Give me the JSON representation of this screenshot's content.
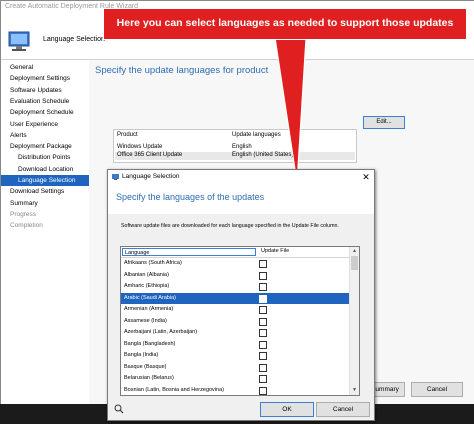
{
  "wizard": {
    "title": "Create Automatic Deployment Rule Wizard",
    "header_title": "Language Selection",
    "nav": [
      {
        "label": "General",
        "indent": 0,
        "state": "normal"
      },
      {
        "label": "Deployment Settings",
        "indent": 0,
        "state": "normal"
      },
      {
        "label": "Software Updates",
        "indent": 0,
        "state": "normal"
      },
      {
        "label": "Evaluation Schedule",
        "indent": 0,
        "state": "normal"
      },
      {
        "label": "Deployment Schedule",
        "indent": 0,
        "state": "normal"
      },
      {
        "label": "User Experience",
        "indent": 0,
        "state": "normal"
      },
      {
        "label": "Alerts",
        "indent": 0,
        "state": "normal"
      },
      {
        "label": "Deployment Package",
        "indent": 0,
        "state": "normal"
      },
      {
        "label": "Distribution Points",
        "indent": 1,
        "state": "normal"
      },
      {
        "label": "Download Location",
        "indent": 1,
        "state": "normal"
      },
      {
        "label": "Language Selection",
        "indent": 1,
        "state": "selected"
      },
      {
        "label": "Download Settings",
        "indent": 0,
        "state": "normal"
      },
      {
        "label": "Summary",
        "indent": 0,
        "state": "normal"
      },
      {
        "label": "Progress",
        "indent": 0,
        "state": "dim"
      },
      {
        "label": "Completion",
        "indent": 0,
        "state": "dim"
      }
    ],
    "content_title": "Specify the update languages for product",
    "edit_button": "Edit...",
    "product_table": {
      "headers": [
        "Product",
        "Update languages"
      ],
      "rows": [
        [
          "Windows Update",
          "English"
        ],
        [
          "Office 365 Client Update",
          "English (United States)"
        ]
      ]
    },
    "summary_button": "Summary",
    "cancel_button": "Cancel"
  },
  "callout": {
    "text": "Here you can select languages as needed to support those updates",
    "color": "#e02020"
  },
  "dialog": {
    "title": "Language Selection",
    "heading": "Specify the languages of the updates",
    "description": "Software update files are downloaded for each language specified in the Update File column.",
    "columns": {
      "language": "Language",
      "update_file": "Update File"
    },
    "languages": [
      {
        "name": "Afrikaans (South Africa)",
        "checked": false,
        "selected": false
      },
      {
        "name": "Albanian (Albania)",
        "checked": false,
        "selected": false
      },
      {
        "name": "Amharic (Ethiopia)",
        "checked": false,
        "selected": false
      },
      {
        "name": "Arabic (Saudi Arabia)",
        "checked": false,
        "selected": true
      },
      {
        "name": "Armenian (Armenia)",
        "checked": false,
        "selected": false
      },
      {
        "name": "Assamese (India)",
        "checked": false,
        "selected": false
      },
      {
        "name": "Azerbaijani (Latin, Azerbaijan)",
        "checked": false,
        "selected": false
      },
      {
        "name": "Bangla (Bangladesh)",
        "checked": false,
        "selected": false
      },
      {
        "name": "Bangla (India)",
        "checked": false,
        "selected": false
      },
      {
        "name": "Basque (Basque)",
        "checked": false,
        "selected": false
      },
      {
        "name": "Belarusian (Belarus)",
        "checked": false,
        "selected": false
      },
      {
        "name": "Bosnian (Latin, Bosnia and Herzegovina)",
        "checked": false,
        "selected": false
      },
      {
        "name": "",
        "checked": false,
        "selected": false
      }
    ],
    "ok_button": "OK",
    "cancel_button": "Cancel"
  },
  "colors": {
    "accent": "#1f64bf",
    "title_blue": "#2c6db3"
  }
}
